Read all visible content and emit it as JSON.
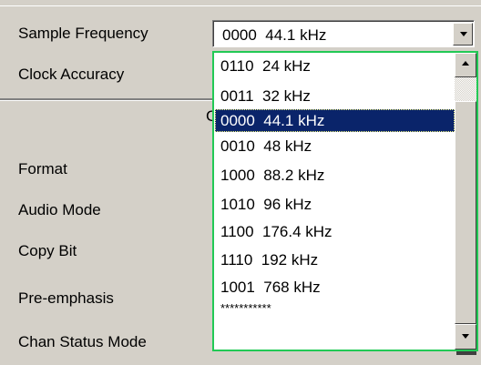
{
  "labels": {
    "sample_frequency": "Sample Frequency",
    "clock_accuracy": "Clock Accuracy",
    "format": "Format",
    "audio_mode": "Audio Mode",
    "copy_bit": "Copy Bit",
    "pre_emphasis": "Pre-emphasis",
    "chan_status_mode": "Chan Status Mode",
    "hidden_fragment": "C"
  },
  "combo": {
    "value": "0000  44.1 kHz"
  },
  "dropdown": {
    "items": [
      "0110  24 kHz",
      "0011  32 kHz",
      "0000  44.1 kHz",
      "0010  48 kHz",
      "1000  88.2 kHz",
      "1010  96 kHz",
      "1100  176.4 kHz",
      "1110  192 kHz",
      "1001  768 kHz",
      "***********"
    ],
    "selected_index": 2
  },
  "icons": {
    "combo_button": "chevron-down-icon",
    "scroll_up": "scroll-up-icon",
    "scroll_down": "scroll-down-icon"
  },
  "colors": {
    "selection": "#0a246a",
    "focus_border": "#22c955",
    "window_bg": "#d4d0c8"
  }
}
